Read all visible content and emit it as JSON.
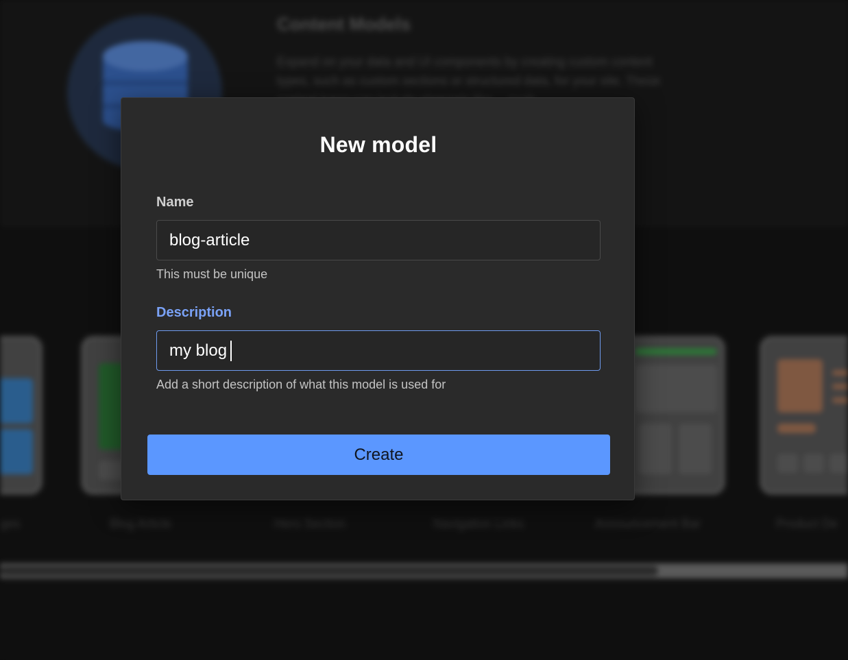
{
  "background": {
    "section_title": "Content Models",
    "section_text": "Expand on your data and UI components by creating custom content types, such as custom sections or structured data, for your site. These content types can include elements like ... such",
    "templates": [
      {
        "label": "Pages"
      },
      {
        "label": "Blog Article"
      },
      {
        "label": "Hero Section"
      },
      {
        "label": "Navigation Links"
      },
      {
        "label": "Announcement Bar"
      },
      {
        "label": "Product De"
      }
    ]
  },
  "modal": {
    "title": "New model",
    "name_field": {
      "label": "Name",
      "value": "blog-article",
      "hint": "This must be unique"
    },
    "description_field": {
      "label": "Description",
      "value": "my blog",
      "hint": "Add a short description of what this model is used for"
    },
    "create_label": "Create"
  },
  "colors": {
    "accent": "#5b97ff",
    "focus_label": "#7aa2f7",
    "modal_bg": "#2a2a2a",
    "page_bg": "#141414"
  }
}
